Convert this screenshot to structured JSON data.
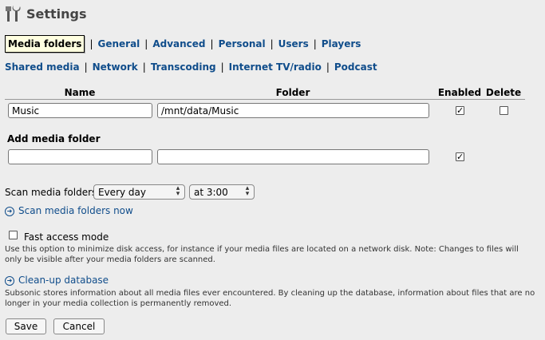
{
  "header": {
    "title": "Settings",
    "icon": "tools-icon"
  },
  "main_tabs": [
    {
      "label": "Media folders",
      "active": true
    },
    {
      "label": "General"
    },
    {
      "label": "Advanced"
    },
    {
      "label": "Personal"
    },
    {
      "label": "Users"
    },
    {
      "label": "Players"
    }
  ],
  "sub_tabs": [
    {
      "label": "Shared media"
    },
    {
      "label": "Network"
    },
    {
      "label": "Transcoding"
    },
    {
      "label": "Internet TV/radio"
    },
    {
      "label": "Podcast"
    }
  ],
  "folders_table": {
    "headers": {
      "name": "Name",
      "folder": "Folder",
      "enabled": "Enabled",
      "delete": "Delete"
    },
    "rows": [
      {
        "name": "Music",
        "folder": "/mnt/data/Music",
        "enabled": true,
        "delete": false
      }
    ]
  },
  "add_folder": {
    "label": "Add media folder",
    "name_value": "",
    "folder_value": "",
    "enabled": true
  },
  "scan": {
    "label": "Scan media folders",
    "frequency": "Every day",
    "time": "at 3:00",
    "scan_now_link": "Scan media folders now"
  },
  "fast_access": {
    "label": "Fast access mode",
    "checked": false,
    "description": "Use this option to minimize disk access, for instance if your media files are located on a network disk. Note: Changes to files will only be visible after your media folders are scanned."
  },
  "cleanup": {
    "link": "Clean-up database",
    "description": "Subsonic stores information about all media files ever encountered. By cleaning up the database, information about files that are no longer in your media collection is permanently removed."
  },
  "buttons": {
    "save": "Save",
    "cancel": "Cancel"
  },
  "colors": {
    "link": "#104d8b",
    "background": "#ededed",
    "active_tab_bg": "#ffffe0"
  }
}
